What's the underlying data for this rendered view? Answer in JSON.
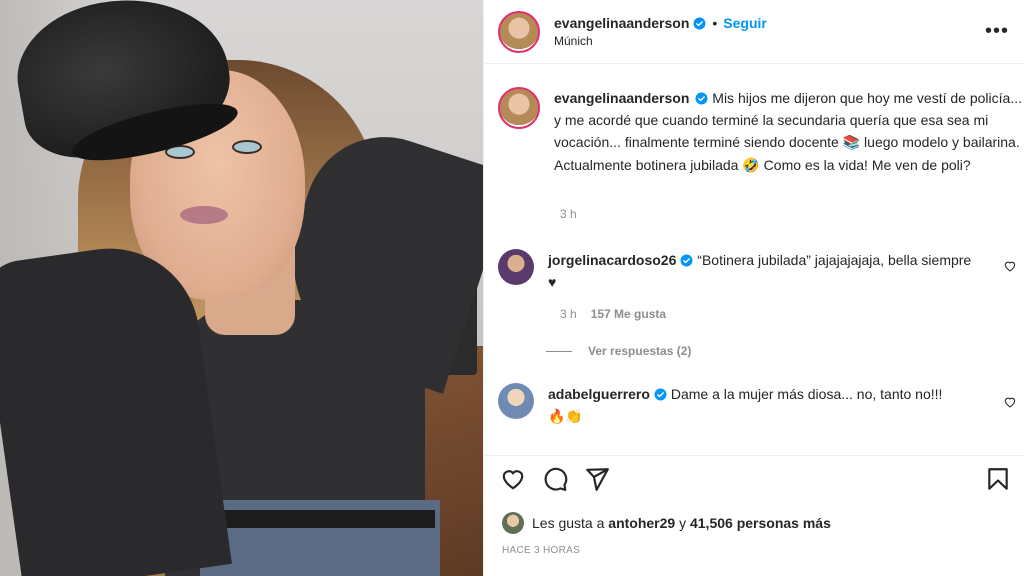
{
  "header": {
    "username": "evangelinaanderson",
    "separator": "•",
    "follow_label": "Seguir",
    "location": "Múnich",
    "more_label": "•••"
  },
  "caption": {
    "username": "evangelinaanderson",
    "text_1": "Mis hijos me dijeron que hoy me vestí de policía... y me acordé que cuando terminé la secundaria quería que esa sea mi vocación... finalmente terminé siendo docente ",
    "emoji_1": "📚",
    "text_2": " luego modelo y bailarina. Actualmente botinera jubilada ",
    "emoji_2": "🤣",
    "text_3": " Como es la vida! Me ven de poli?",
    "time": "3 h"
  },
  "comments": [
    {
      "username": "jorgelinacardoso26",
      "text": "“Botinera jubilada” jajajajajaja, bella siempre ♥",
      "time": "3 h",
      "likes": "157 Me gusta"
    },
    {
      "username": "adabelguerrero",
      "text": "Dame a la mujer más diosa... no, tanto no!!!",
      "emoji": "🔥👏"
    }
  ],
  "replies_label": "Ver respuestas (2)",
  "actions": {
    "icons": [
      "heart-icon",
      "comment-icon",
      "share-icon",
      "save-icon"
    ]
  },
  "likes": {
    "prefix": "Les gusta a ",
    "user": "antoher29",
    "middle": " y ",
    "count": "41,506 personas más"
  },
  "time_ago": "HACE 3 HORAS",
  "colors": {
    "accent": "#0095f6",
    "verified": "#0095f6",
    "muted": "#8e8e8e",
    "border": "#efefef"
  }
}
